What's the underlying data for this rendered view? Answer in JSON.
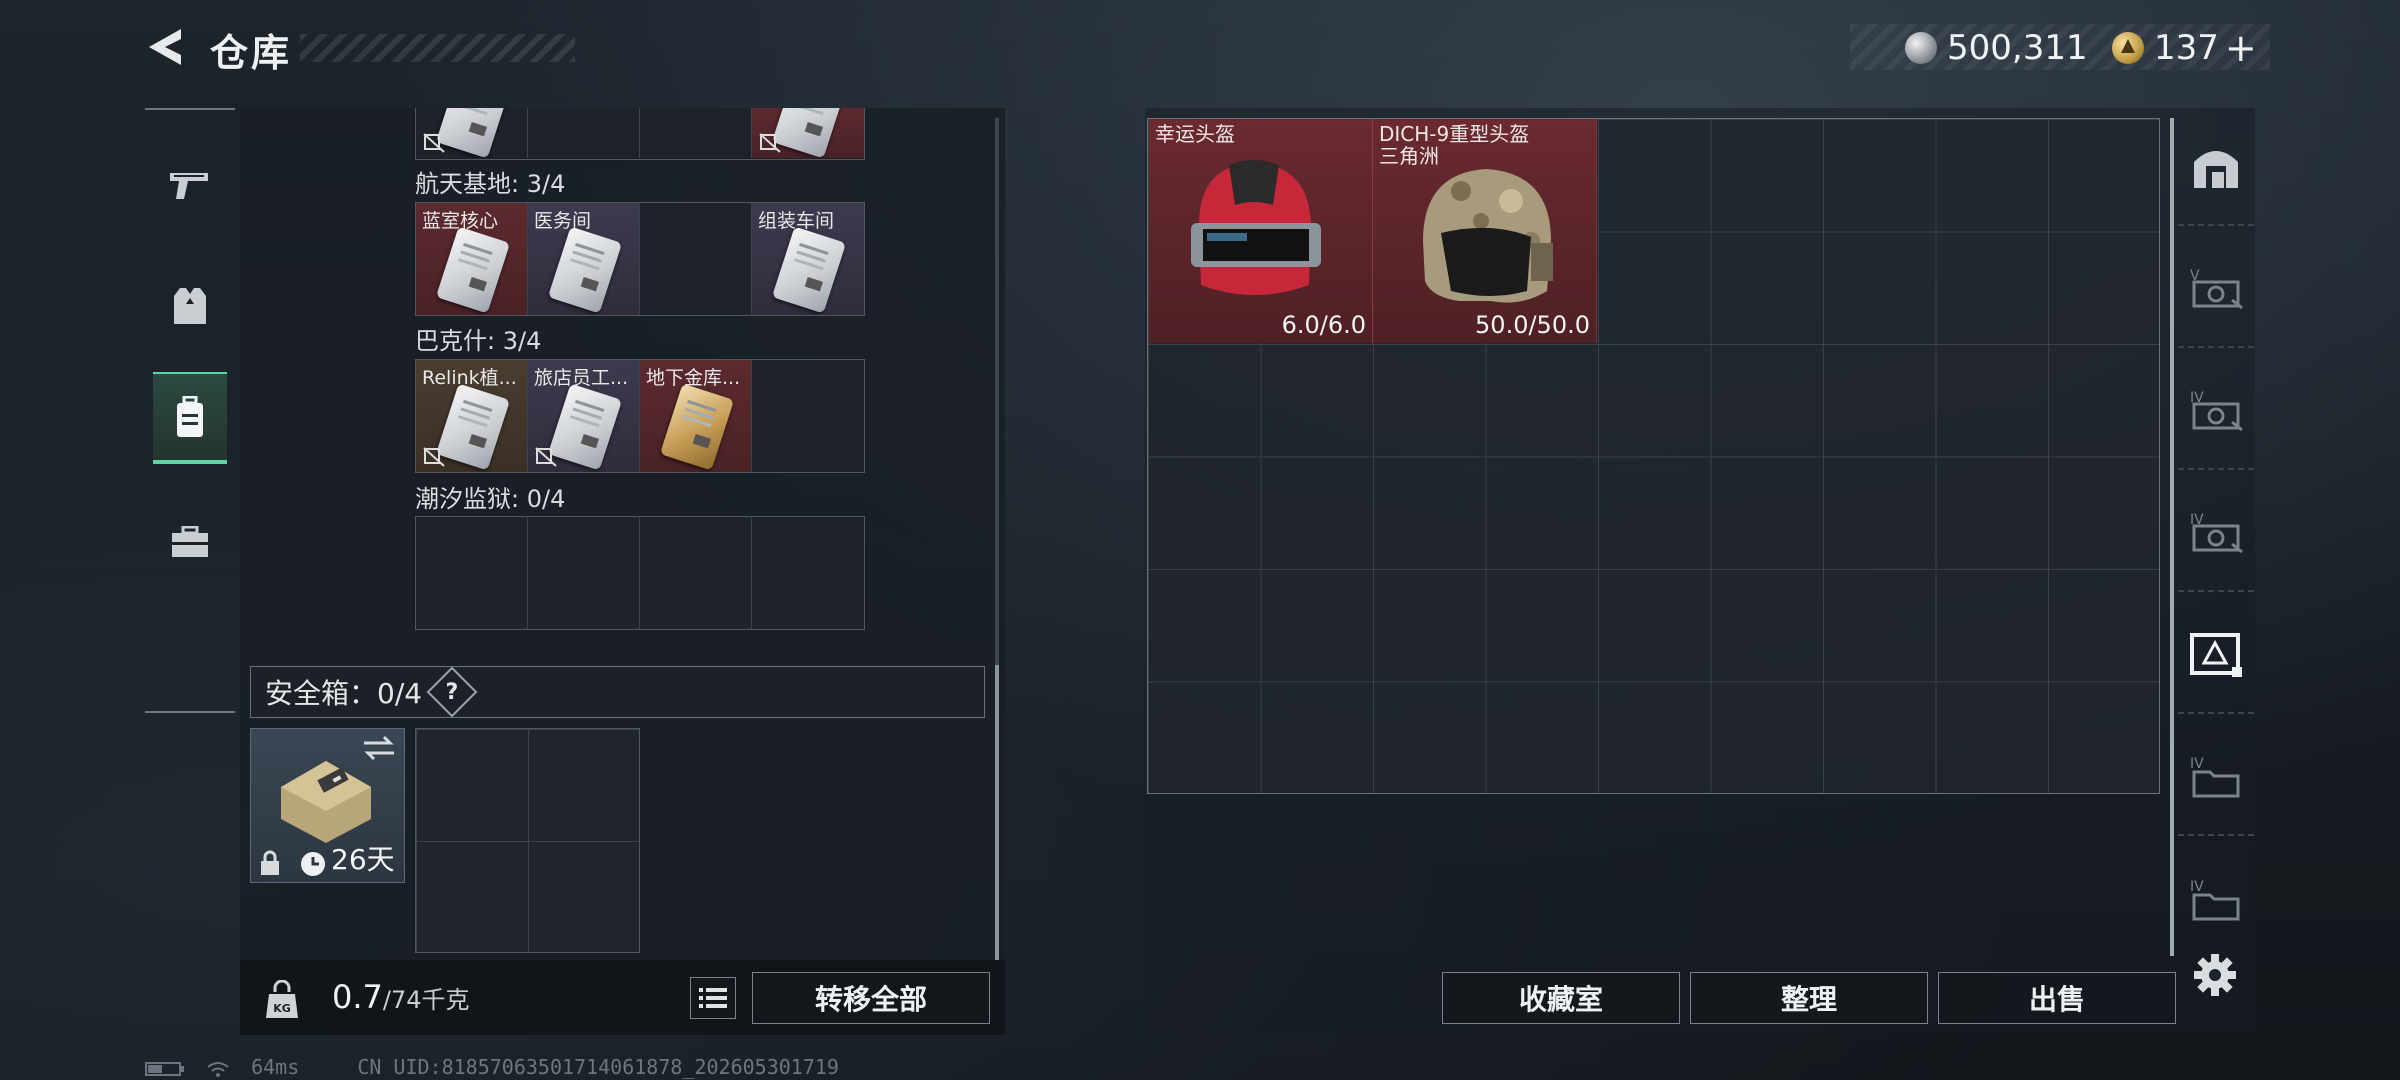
{
  "header": {
    "title": "仓库",
    "silver_amount": "500,311",
    "gold_amount": "137",
    "plus_label": "+"
  },
  "left_tabs": [
    {
      "name": "weapons",
      "icon": "pistol-icon"
    },
    {
      "name": "equipment",
      "icon": "armor-vest-icon"
    },
    {
      "name": "containers",
      "icon": "backpack-icon",
      "active": true
    },
    {
      "name": "toolbox",
      "icon": "briefcase-icon"
    }
  ],
  "key_groups": [
    {
      "label": "航天基地: 3/4",
      "slots": [
        {
          "name": "蓝室核心",
          "style": "red"
        },
        {
          "name": "医务间",
          "style": "purple"
        },
        {
          "name": "",
          "style": "empty"
        },
        {
          "name": "组装车间",
          "style": "purple"
        }
      ]
    },
    {
      "label": "巴克什: 3/4",
      "slots": [
        {
          "name": "Relink植...",
          "style": "brown",
          "nodrop": true
        },
        {
          "name": "旅店员工...",
          "style": "purple",
          "nodrop": true
        },
        {
          "name": "地下金库...",
          "style": "red",
          "gold": true
        },
        {
          "name": "",
          "style": "empty"
        }
      ]
    },
    {
      "label": "潮汐监狱: 0/4",
      "slots": []
    }
  ],
  "safe_box": {
    "label": "安全箱：0/4",
    "help": "?",
    "days_left": "26天"
  },
  "bottom": {
    "weight_current": "0.7",
    "weight_max": "/74千克",
    "transfer_all": "转移全部"
  },
  "stash_items": [
    {
      "name": "幸运头盔",
      "subname": "",
      "durability": "6.0/6.0"
    },
    {
      "name": "DICH-9重型头盔",
      "subname": "三角洲",
      "durability": "50.0/50.0"
    }
  ],
  "right_buttons": {
    "collection": "收藏室",
    "organize": "整理",
    "sell": "出售"
  },
  "side_tabs": [
    {
      "name": "home",
      "icon": "home-icon"
    },
    {
      "name": "stash-v",
      "icon": "case-v-icon",
      "label": "V"
    },
    {
      "name": "stash-iv-a",
      "icon": "case-iv-icon",
      "label": "IV"
    },
    {
      "name": "stash-iv-b",
      "icon": "case-iv-icon",
      "label": "IV"
    },
    {
      "name": "stash-active",
      "icon": "case-active-icon"
    },
    {
      "name": "stash-iv-c",
      "icon": "folder-iv-icon",
      "label": "IV"
    },
    {
      "name": "stash-iv-d",
      "icon": "folder-iv-icon",
      "label": "IV"
    }
  ],
  "status": {
    "ping": "64ms",
    "uid": "CN UID:81857063501714061878_202605301719"
  },
  "colors": {
    "accent_green": "#5ad6a3",
    "rare_red": "#6a2a30",
    "epic_purple": "#3c3a4e"
  }
}
